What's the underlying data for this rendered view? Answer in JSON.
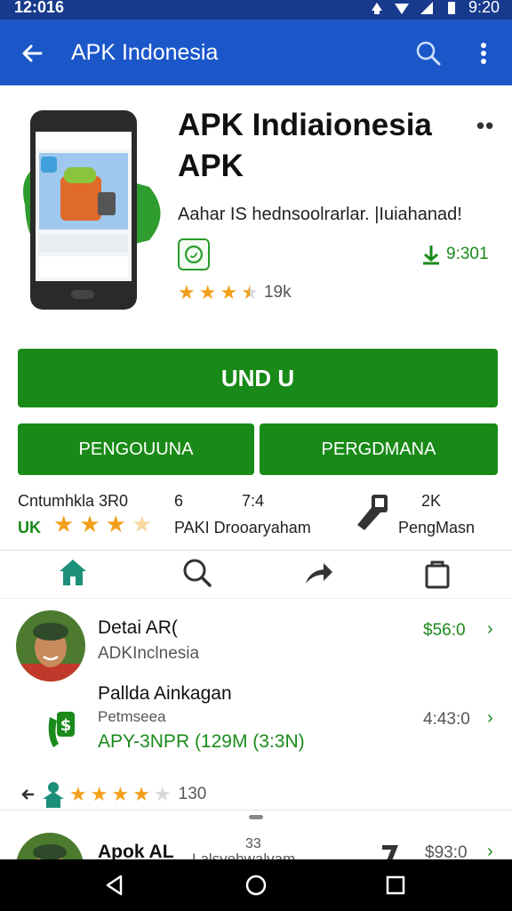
{
  "status_bar": {
    "time_left": "12:016",
    "time_right": "9:20"
  },
  "app_bar": {
    "title": "APK Indonesia",
    "back_icon": "arrow-left-icon",
    "search_icon": "search-icon",
    "more_icon": "more-vert-icon"
  },
  "hero": {
    "app_name_line1": "APK Indiaionesia",
    "app_name_line2": "APK",
    "description": "Aahar IS hednsoolrarlar. |Iuiahanad!",
    "size": "9:301",
    "rating_stars": 3.5,
    "rating_count": "19k"
  },
  "buttons": {
    "primary": "UND U",
    "secondary_left": "PENGOUUNA",
    "secondary_right": "PERGDMANA"
  },
  "stats": {
    "col1_top": "Cntumhkla 3R0",
    "col1_bottom": "UK",
    "col1_stars": 3.5,
    "col2_top": "6",
    "col3_top": "7:4",
    "col23_bottom": "PAKI Drooaryaham",
    "col4_top": "2K",
    "col4_bottom": "PengMasn"
  },
  "tabs": [
    "home-icon",
    "search-icon",
    "share-icon",
    "bag-icon"
  ],
  "list": [
    {
      "title": "Detai AR(",
      "subtitle": "ADKInclnesia",
      "price": "$56:0",
      "chevron": "›"
    },
    {
      "title": "Pallda Ainkagan",
      "subtitle": "Petmseea",
      "detail": "APY-3NPR (129M (3:3N)",
      "price": "4:43:0",
      "chevron": "›"
    }
  ],
  "rating_row": {
    "stars": 4,
    "count": "130"
  },
  "partial_item": {
    "title": "Apok AL",
    "mid_top": "33",
    "mid_bottom": "Lalsvehwalvam",
    "price": "$93:0"
  },
  "colors": {
    "app_bar": "#1b57c9",
    "status_bar": "#173a8c",
    "accent_green": "#198a17",
    "star": "#f2a01c"
  }
}
